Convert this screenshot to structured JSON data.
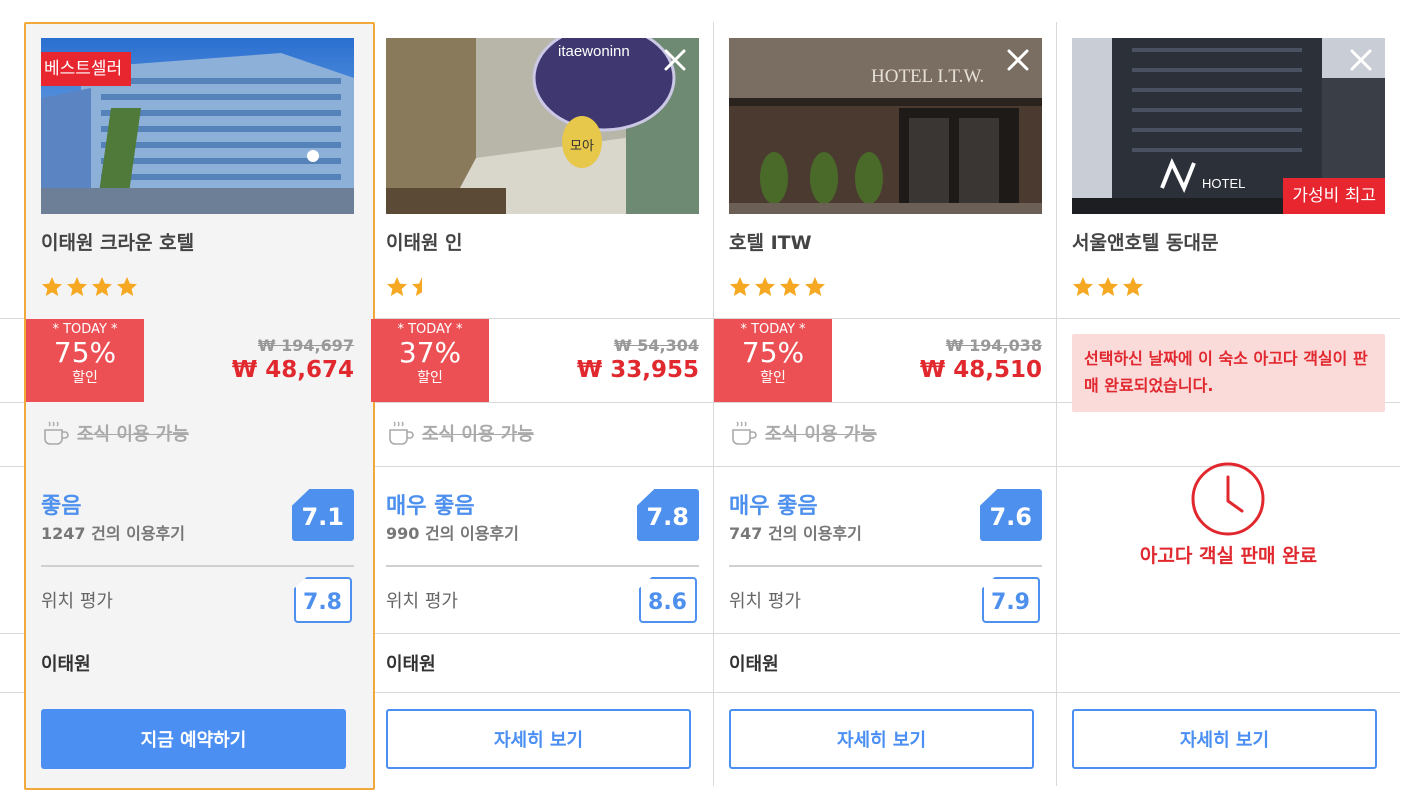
{
  "colors": {
    "accent": "#4b8ff2",
    "sale": "#ec5054",
    "price": "#e0282e",
    "star": "#f7a823",
    "highlight_border": "#f2a93b"
  },
  "hotels": [
    {
      "name": "이태원 크라운 호텔",
      "badge": "베스트셀러",
      "stars": 4,
      "today_label": "* TODAY *",
      "discount": "75%",
      "discount_suffix": "할인",
      "original_price": "₩ 194,697",
      "price": "₩ 48,674",
      "breakfast": "조식 이용 가능",
      "rating_label": "좋음",
      "reviews": "1247 건의 이용후기",
      "score": "7.1",
      "location_label": "위치 평가",
      "location_score": "7.8",
      "area": "이태원",
      "button": "지금 예약하기"
    },
    {
      "name": "이태원 인",
      "stars": 1.5,
      "today_label": "* TODAY *",
      "discount": "37%",
      "discount_suffix": "할인",
      "original_price": "₩ 54,304",
      "price": "₩ 33,955",
      "breakfast": "조식 이용 가능",
      "rating_label": "매우 좋음",
      "reviews": "990 건의 이용후기",
      "score": "7.8",
      "location_label": "위치 평가",
      "location_score": "8.6",
      "area": "이태원",
      "button": "자세히 보기",
      "photo_sign": "itaewoninn",
      "photo_sign2": "모아"
    },
    {
      "name": "호텔 ITW",
      "stars": 4,
      "today_label": "* TODAY *",
      "discount": "75%",
      "discount_suffix": "할인",
      "original_price": "₩ 194,038",
      "price": "₩ 48,510",
      "breakfast": "조식 이용 가능",
      "rating_label": "매우 좋음",
      "reviews": "747 건의 이용후기",
      "score": "7.6",
      "location_label": "위치 평가",
      "location_score": "7.9",
      "area": "이태원",
      "button": "자세히 보기",
      "photo_sign": "HOTEL I.T.W."
    },
    {
      "name": "서울앤호텔 동대문",
      "badge": "가성비 최고",
      "stars": 3,
      "sold_message": "선택하신 날짜에 이 숙소 아고다 객실이 판매 완료되었습니다.",
      "sold_out": "아고다 객실 판매 완료",
      "button": "자세히 보기",
      "photo_sign": "HOTEL"
    }
  ]
}
